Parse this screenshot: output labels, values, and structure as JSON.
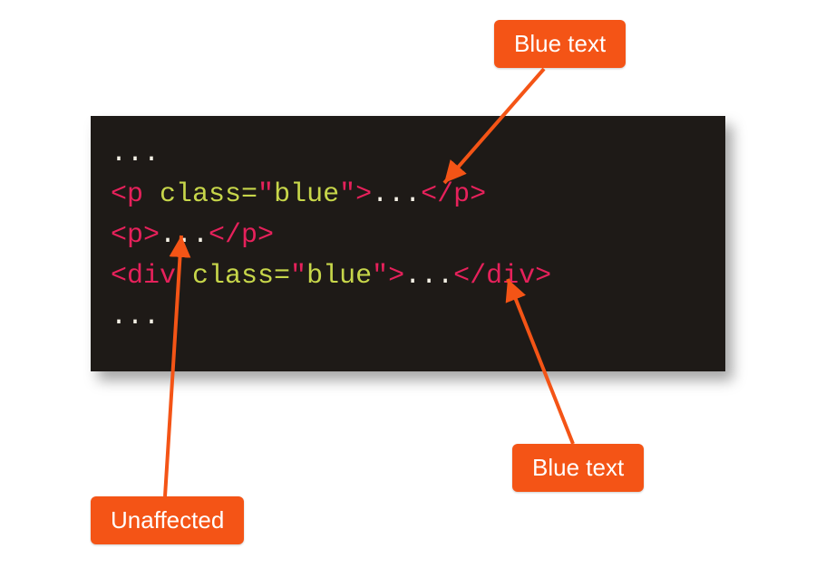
{
  "callouts": {
    "top": "Blue text",
    "bottom_right": "Blue text",
    "bottom_left": "Unaffected"
  },
  "code": {
    "l1_ellipsis": "...",
    "l2_open": "<p ",
    "l2_attr": "class=",
    "l2_q1": "\"",
    "l2_val": "blue",
    "l2_q2": "\"",
    "l2_gt": ">",
    "l2_mid": "...",
    "l2_close": "</p>",
    "l3_open": "<p>",
    "l3_mid": "...",
    "l3_close": "</p>",
    "l4_open": "<div ",
    "l4_attr": "class=",
    "l4_q1": "\"",
    "l4_val": "blue",
    "l4_q2": "\"",
    "l4_gt": ">",
    "l4_mid": "...",
    "l4_close": "</div>",
    "l5_ellipsis": "..."
  },
  "colors": {
    "panel_bg": "#1e1a17",
    "callout_bg": "#f45416",
    "token_tag": "#e6215b",
    "token_attr": "#c7d64a",
    "token_punc": "#f5f1e6"
  }
}
